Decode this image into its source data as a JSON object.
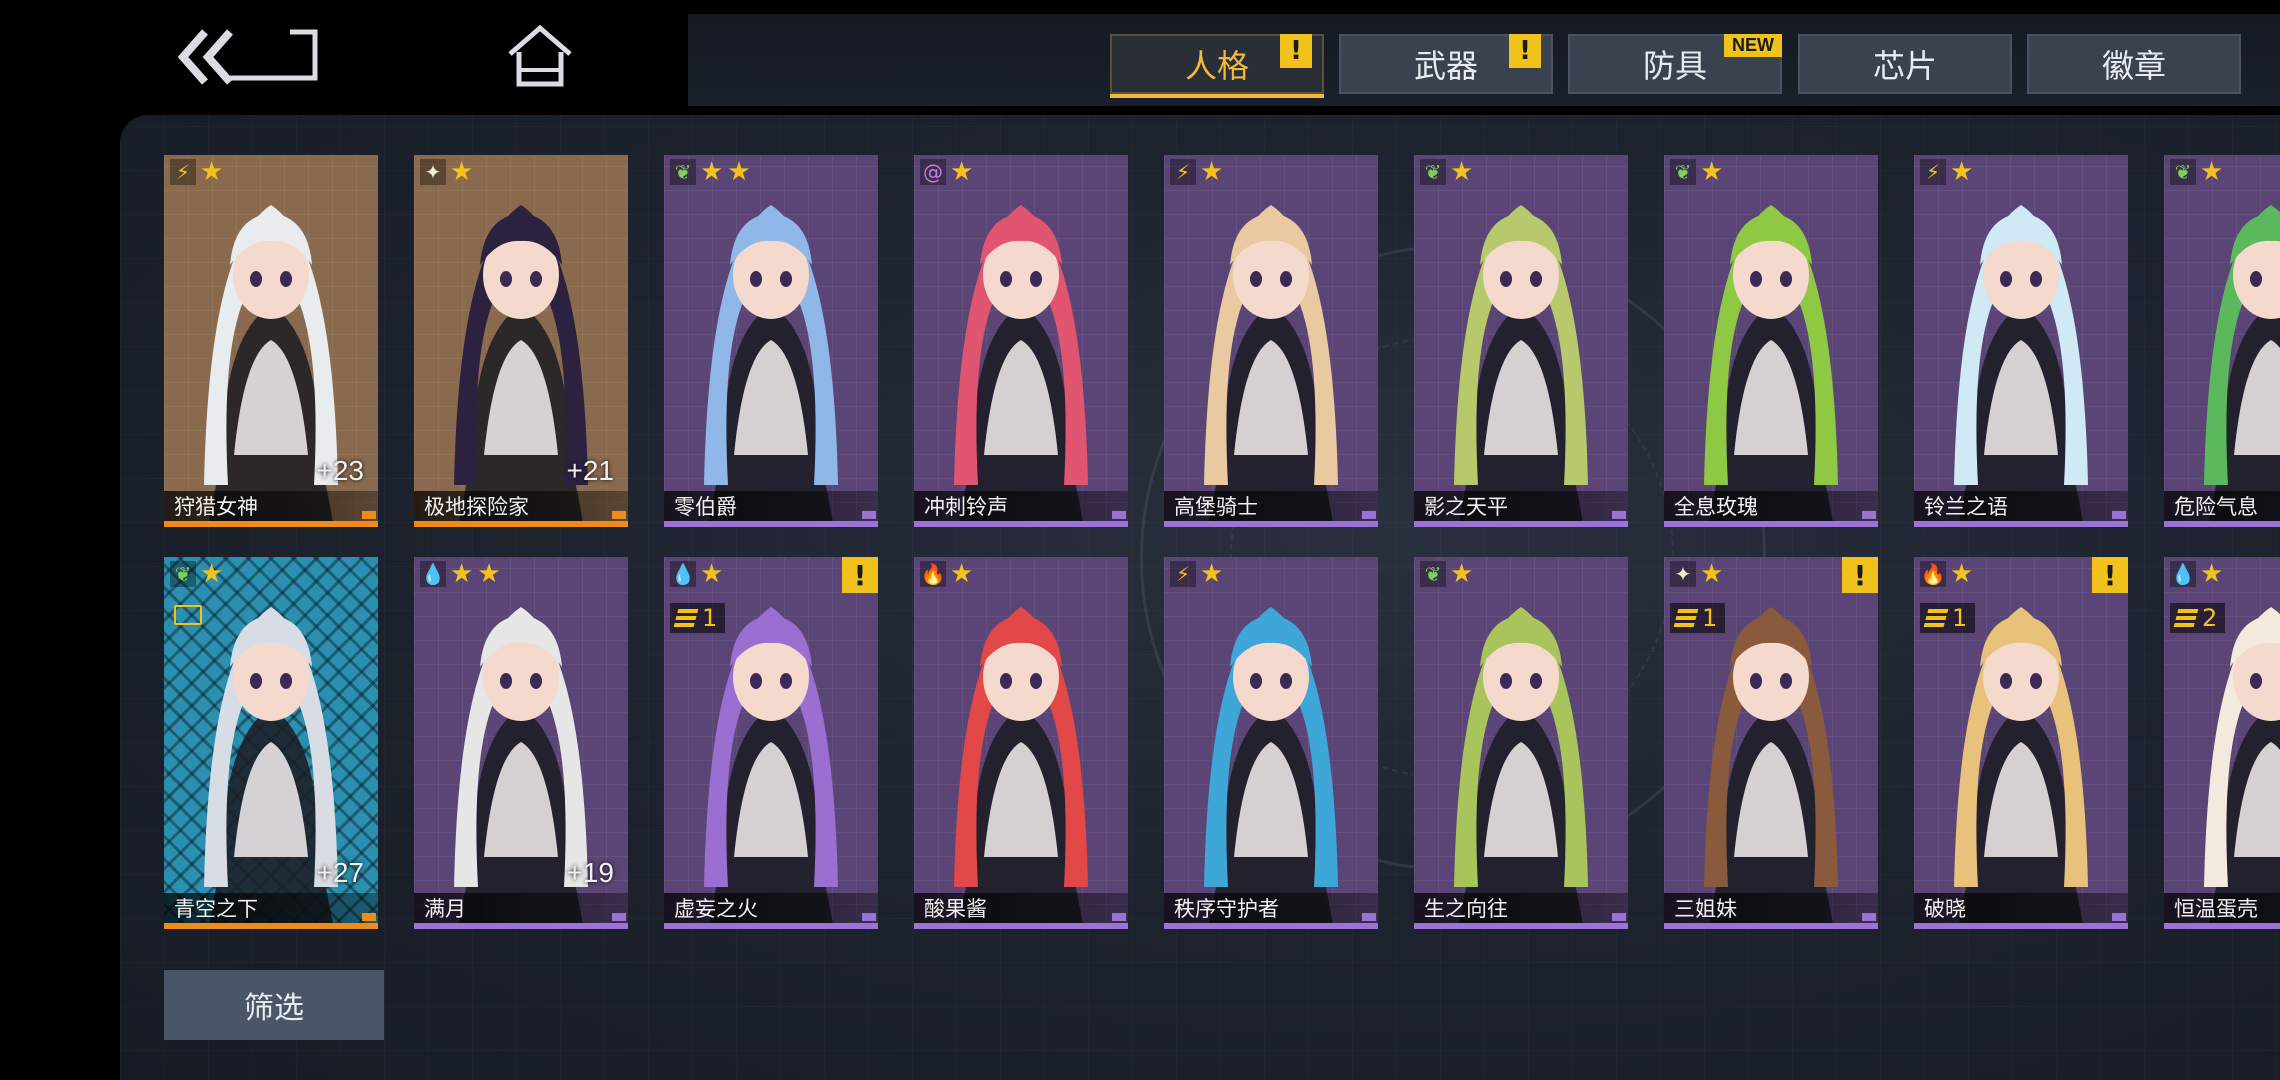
{
  "nav": {
    "back_icon": "double-chevron-back-icon",
    "home_icon": "home-icon"
  },
  "tabs": [
    {
      "label": "人格",
      "active": true,
      "alert": "!"
    },
    {
      "label": "武器",
      "active": false,
      "alert": "!"
    },
    {
      "label": "防具",
      "active": false,
      "badge": "NEW"
    },
    {
      "label": "芯片",
      "active": false
    },
    {
      "label": "徽章",
      "active": false
    }
  ],
  "cards": [
    {
      "name": "狩猎女神",
      "element": "lightning",
      "stars": 1,
      "plus": "+23",
      "rarity": "orange",
      "bg": "#8a6a4e",
      "hair": "#e8ecef"
    },
    {
      "name": "极地探险家",
      "element": "light",
      "stars": 1,
      "plus": "+21",
      "rarity": "orange",
      "bg": "#8a6a4e",
      "hair": "#2d2140"
    },
    {
      "name": "零伯爵",
      "element": "wind",
      "stars": 2,
      "rarity": "purple",
      "bg": "#5a4576",
      "hair": "#8fb8e8"
    },
    {
      "name": "冲刺铃声",
      "element": "psychic",
      "stars": 1,
      "rarity": "purple",
      "bg": "#5a4576",
      "hair": "#e0556f"
    },
    {
      "name": "高堡骑士",
      "element": "lightning",
      "stars": 1,
      "rarity": "purple",
      "bg": "#5a4576",
      "hair": "#e8c9a0"
    },
    {
      "name": "影之天平",
      "element": "wind",
      "stars": 1,
      "rarity": "purple",
      "bg": "#5a4576",
      "hair": "#b7c96a"
    },
    {
      "name": "全息玫瑰",
      "element": "wind",
      "stars": 1,
      "rarity": "purple",
      "bg": "#5a4576",
      "hair": "#8fc843"
    },
    {
      "name": "铃兰之语",
      "element": "lightning",
      "stars": 1,
      "rarity": "purple",
      "bg": "#5a4576",
      "hair": "#cfe9f5"
    },
    {
      "name": "危险气息",
      "element": "wind",
      "stars": 1,
      "rarity": "purple",
      "bg": "#5a4576",
      "hair": "#5cb85c"
    },
    {
      "name": "青空之下",
      "element": "wind",
      "stars": 1,
      "plus": "+27",
      "rarity": "orange",
      "bg": "blue",
      "hair": "#d8dde5",
      "chip": true
    },
    {
      "name": "满月",
      "element": "water",
      "stars": 2,
      "plus": "+19",
      "rarity": "purple",
      "bg": "#5a4576",
      "hair": "#e6e6e6"
    },
    {
      "name": "虚妄之火",
      "element": "water",
      "stars": 1,
      "rarity": "purple",
      "bg": "#5a4576",
      "hair": "#9a6fd1",
      "alert": "!",
      "rank": "1"
    },
    {
      "name": "酸果酱",
      "element": "fire",
      "stars": 1,
      "rarity": "purple",
      "bg": "#5a4576",
      "hair": "#e24848"
    },
    {
      "name": "秩序守护者",
      "element": "lightning",
      "stars": 1,
      "rarity": "purple",
      "bg": "#5a4576",
      "hair": "#3fa6d8"
    },
    {
      "name": "生之向往",
      "element": "wind",
      "stars": 1,
      "rarity": "purple",
      "bg": "#5a4576",
      "hair": "#a9c45a"
    },
    {
      "name": "三姐妹",
      "element": "light",
      "stars": 1,
      "rarity": "purple",
      "bg": "#5a4576",
      "hair": "#8a5a3c",
      "alert": "!",
      "rank": "1"
    },
    {
      "name": "破晓",
      "element": "fire",
      "stars": 1,
      "rarity": "purple",
      "bg": "#5a4576",
      "hair": "#e8c27a",
      "alert": "!",
      "rank": "1"
    },
    {
      "name": "恒温蛋壳",
      "element": "water",
      "stars": 1,
      "rarity": "purple",
      "bg": "#5a4576",
      "hair": "#f2eadc",
      "rank": "2"
    }
  ],
  "filter_label": "筛选",
  "colors": {
    "accent": "#f3b93a",
    "alert": "#f1c21b",
    "purple_rarity": "#9b72d6",
    "orange_rarity": "#f08a18"
  }
}
